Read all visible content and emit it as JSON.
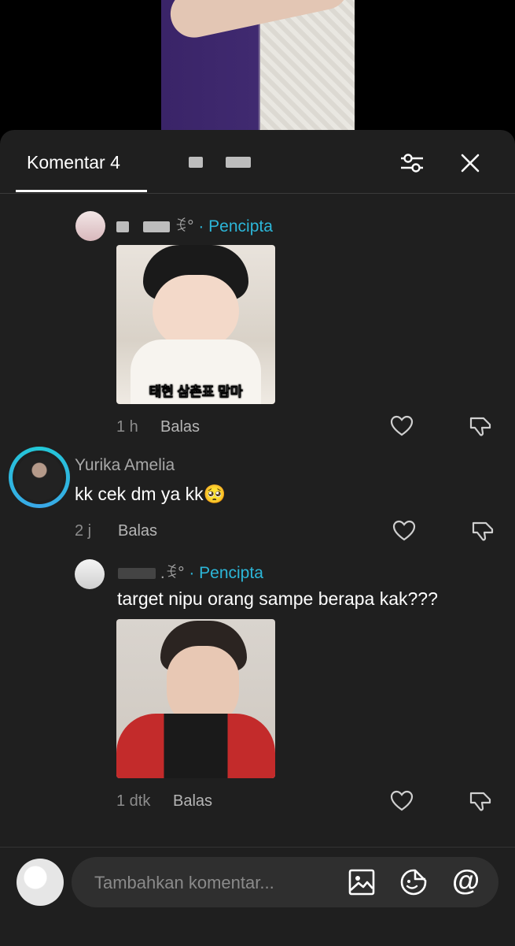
{
  "header": {
    "tab_comments": "Komentar 4",
    "filter_icon": "sliders-icon",
    "close_icon": "close-icon"
  },
  "comments": [
    {
      "author_suffix": "ꉂ°",
      "creator_badge": "· Pencipta",
      "sticker_caption": "태현 삼촌표 맘마",
      "time": "1 h",
      "reply_label": "Balas"
    },
    {
      "author": "Yurika Amelia",
      "text": "kk cek dm ya kk🥺",
      "time": "2 j",
      "reply_label": "Balas"
    },
    {
      "author_suffix": ".ꉂ°",
      "creator_badge": "· Pencipta",
      "text": "target nipu orang sampe berapa kak???",
      "time": "1 dtk",
      "reply_label": "Balas"
    }
  ],
  "composer": {
    "placeholder": "Tambahkan komentar...",
    "image_icon": "image-icon",
    "emoji_icon": "sticker-emoji-icon",
    "mention_icon": "at-mention-icon",
    "mention_glyph": "@"
  }
}
